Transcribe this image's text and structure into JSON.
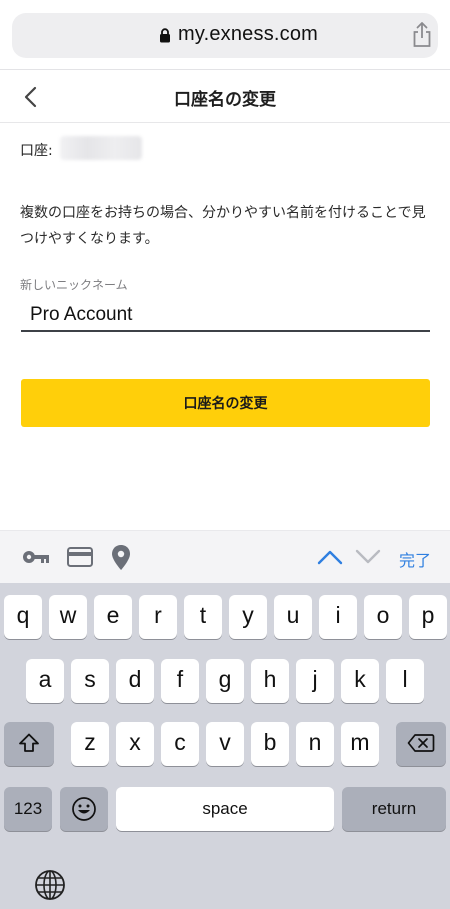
{
  "browser": {
    "url": "my.exness.com",
    "lock_icon": "lock-icon",
    "share_icon": "share-icon"
  },
  "header": {
    "back_icon": "chevron-left-icon",
    "title": "口座名の変更"
  },
  "content": {
    "account_label": "口座:",
    "account_value_blurred": true,
    "description": "複数の口座をお持ちの場合、分かりやすい名前を付けることで見つけやすくなります。",
    "nickname_label": "新しいニックネーム",
    "nickname_value": "Pro Account",
    "submit_label": "口座名の変更"
  },
  "accessory_bar": {
    "icons": [
      "key-icon",
      "credit-card-icon",
      "location-pin-icon",
      "chevron-up-icon",
      "chevron-down-icon"
    ],
    "done_label": "完了"
  },
  "keyboard": {
    "row1": [
      "q",
      "w",
      "e",
      "r",
      "t",
      "y",
      "u",
      "i",
      "o",
      "p"
    ],
    "row2": [
      "a",
      "s",
      "d",
      "f",
      "g",
      "h",
      "j",
      "k",
      "l"
    ],
    "row3": [
      "z",
      "x",
      "c",
      "v",
      "b",
      "n",
      "m"
    ],
    "numbers_label": "123",
    "space_label": "space",
    "return_label": "return"
  },
  "colors": {
    "accent_button": "#ffcf0a",
    "link_blue": "#2f7fe0",
    "keyboard_bg": "#d2d4dc"
  }
}
